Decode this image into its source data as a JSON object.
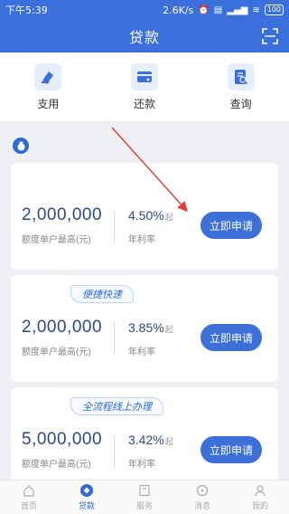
{
  "status": {
    "time": "下午5:39",
    "net_speed": "2.6K/s",
    "battery": "100"
  },
  "header": {
    "title": "贷款"
  },
  "quick_actions": [
    {
      "label": "支用",
      "icon": "withdraw-icon"
    },
    {
      "label": "还款",
      "icon": "repay-icon"
    },
    {
      "label": "查询",
      "icon": "query-icon"
    }
  ],
  "products": [
    {
      "tag": "",
      "amount": "2,000,000",
      "amount_label": "额度单户最高(元)",
      "rate": "4.50%",
      "rate_suffix": "起",
      "rate_label": "年利率",
      "button": "立即申请"
    },
    {
      "tag": "便捷快速",
      "amount": "2,000,000",
      "amount_label": "额度单户最高(元)",
      "rate": "3.85%",
      "rate_suffix": "起",
      "rate_label": "年利率",
      "button": "立即申请"
    },
    {
      "tag": "全流程线上办理",
      "amount": "5,000,000",
      "amount_label": "额度单户最高(元)",
      "rate": "3.42%",
      "rate_suffix": "起",
      "rate_label": "年利率",
      "button": "立即申请"
    }
  ],
  "tabs": [
    {
      "label": "首页",
      "icon": "home-icon",
      "active": false
    },
    {
      "label": "贷款",
      "icon": "loan-icon",
      "active": true
    },
    {
      "label": "服务",
      "icon": "service-icon",
      "active": false
    },
    {
      "label": "消息",
      "icon": "message-icon",
      "active": false
    },
    {
      "label": "我的",
      "icon": "profile-icon",
      "active": false
    }
  ],
  "colors": {
    "primary": "#3a6fdc",
    "accent": "#2e6ad6",
    "annotation_arrow": "#e53935"
  }
}
